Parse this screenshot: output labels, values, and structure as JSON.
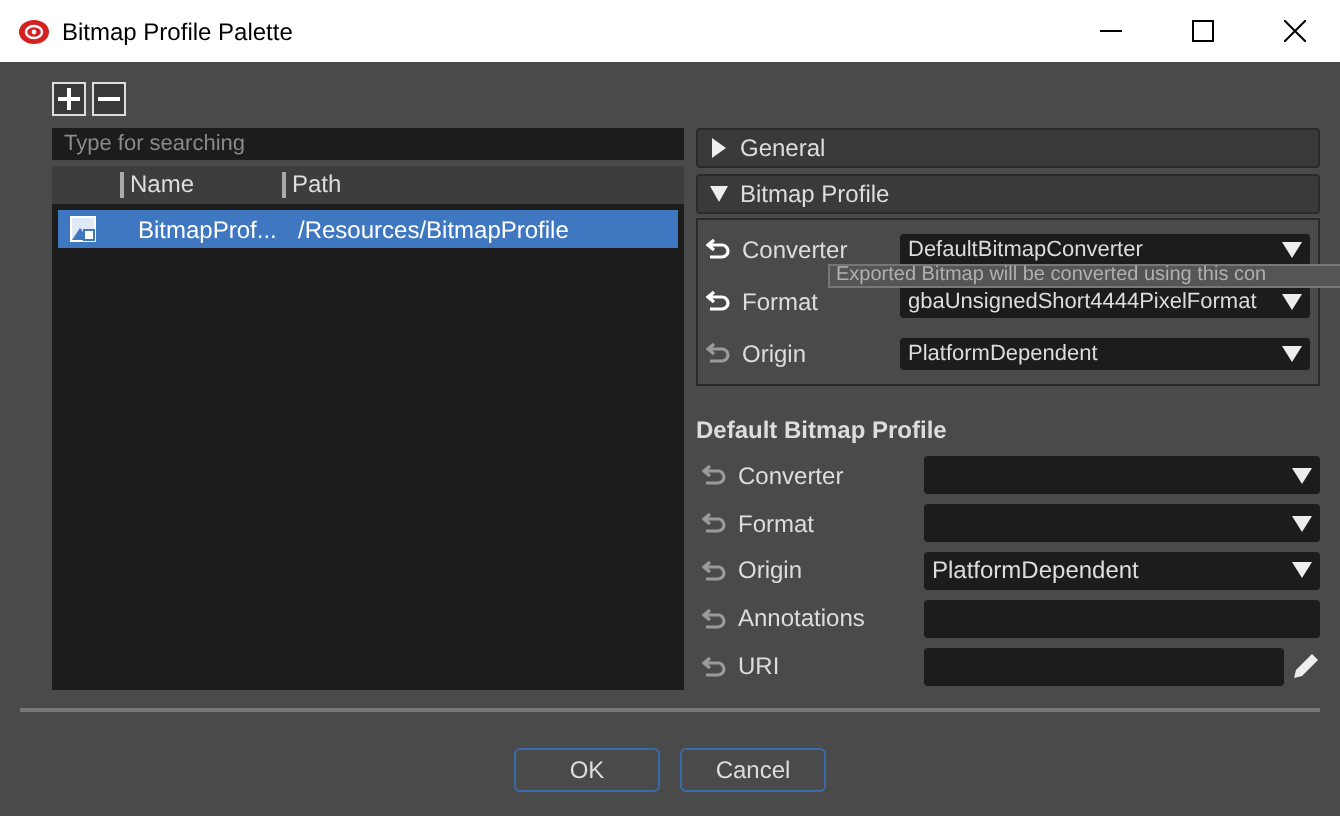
{
  "window": {
    "title": "Bitmap Profile Palette"
  },
  "search": {
    "placeholder": "Type for searching"
  },
  "table": {
    "columns": [
      "Name",
      "Path"
    ],
    "rows": [
      {
        "name": "BitmapProf...",
        "path": "/Resources/BitmapProfile",
        "selected": true
      }
    ]
  },
  "sections": [
    {
      "title": "General",
      "expanded": false
    },
    {
      "title": "Bitmap Profile",
      "expanded": true,
      "rows": [
        {
          "label": "Converter",
          "modified": true,
          "kind": "dropdown",
          "value": "DefaultBitmapConverter"
        },
        {
          "label": "Format",
          "modified": true,
          "kind": "dropdown",
          "value": "gbaUnsignedShort4444PixelFormat"
        },
        {
          "label": "Origin",
          "modified": false,
          "kind": "dropdown",
          "value": "PlatformDependent"
        }
      ]
    }
  ],
  "tooltip": "Exported Bitmap will be converted using this con",
  "default_profile": {
    "title": "Default Bitmap Profile",
    "rows": [
      {
        "label": "Converter",
        "modified": false,
        "kind": "dropdown",
        "value": ""
      },
      {
        "label": "Format",
        "modified": false,
        "kind": "dropdown",
        "value": ""
      },
      {
        "label": "Origin",
        "modified": false,
        "kind": "dropdown",
        "value": "PlatformDependent"
      },
      {
        "label": "Annotations",
        "modified": false,
        "kind": "text",
        "value": ""
      },
      {
        "label": "URI",
        "modified": false,
        "kind": "uri",
        "value": ""
      }
    ]
  },
  "buttons": [
    "OK",
    "Cancel"
  ]
}
